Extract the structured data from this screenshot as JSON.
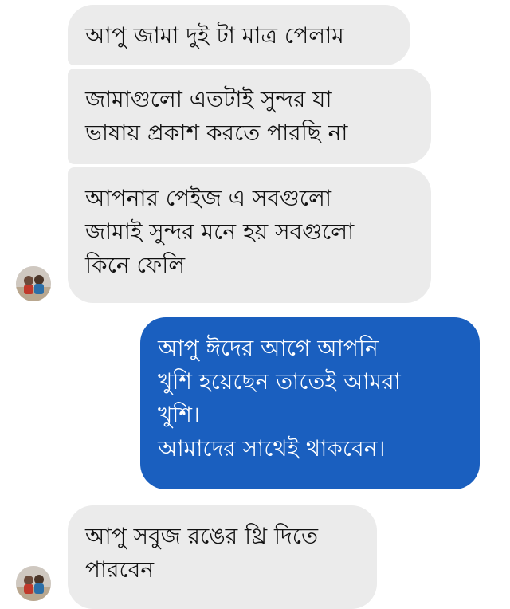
{
  "conversation": {
    "messages": [
      {
        "direction": "incoming",
        "lines": [
          "আপু জামা দুই টা মাত্র পেলাম"
        ]
      },
      {
        "direction": "incoming",
        "lines": [
          "জামাগুলো এতটাই সুন্দর যা",
          "ভাষায় প্রকাশ করতে পারছি না"
        ]
      },
      {
        "direction": "incoming",
        "lines": [
          "আপনার পেইজ এ সবগুলো",
          "জামাই সুন্দর মনে হয় সবগুলো",
          "কিনে ফেলি"
        ]
      },
      {
        "direction": "outgoing",
        "lines": [
          "আপু ঈদের আগে আপনি",
          "খুশি হয়েছেন তাতেই আমরা",
          "খুশি।",
          "আমাদের সাথেই থাকবেন।"
        ]
      },
      {
        "direction": "incoming",
        "lines": [
          "আপু সবুজ রঙের থ্রি দিতে",
          "পারবেন"
        ]
      }
    ]
  },
  "colors": {
    "incoming_bubble": "#ebebeb",
    "outgoing_bubble": "#1a5fbf",
    "incoming_text": "#111111",
    "outgoing_text": "#ffffff"
  },
  "icons": {
    "sender_avatar": "avatar-photo"
  }
}
